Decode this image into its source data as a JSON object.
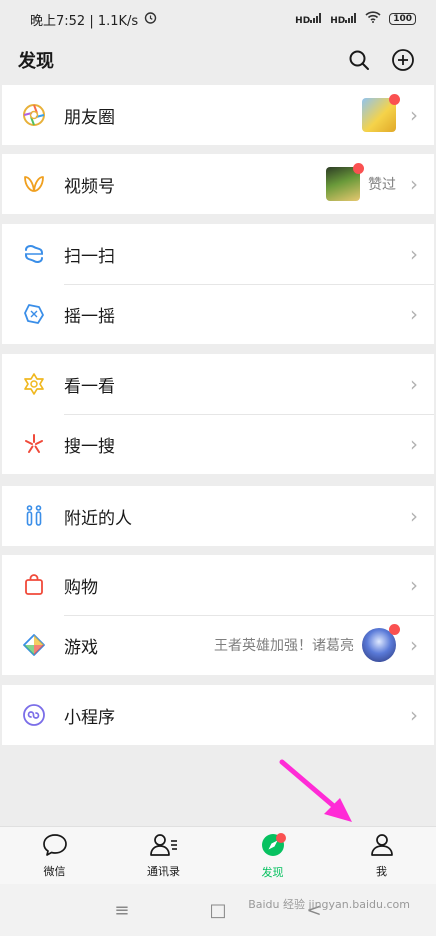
{
  "status": {
    "left_text": "晚上7:52 | 1.1K/s",
    "alarm_icon": "alarm-icon",
    "signal1": "HD",
    "signal2": "HD",
    "battery": "100"
  },
  "header": {
    "title": "发现",
    "search_icon": "search-icon",
    "add_icon": "plus-circle-icon"
  },
  "groups": {
    "moments": {
      "label": "朋友圈"
    },
    "channels": {
      "label": "视频号",
      "sub": "赞过"
    },
    "scan": {
      "label": "扫一扫"
    },
    "shake": {
      "label": "摇一摇"
    },
    "topstories": {
      "label": "看一看"
    },
    "search": {
      "label": "搜一搜"
    },
    "nearby": {
      "label": "附近的人"
    },
    "shopping": {
      "label": "购物"
    },
    "games": {
      "label": "游戏",
      "sub": "王者英雄加强！诸葛亮"
    },
    "miniprogram": {
      "label": "小程序"
    }
  },
  "tabbar": {
    "chats": "微信",
    "contacts": "通讯录",
    "discover": "发现",
    "me": "我"
  },
  "navbar": {
    "menu": "≡",
    "home": "□",
    "back": "<"
  },
  "watermark": "Baidu 经验 jingyan.baidu.com",
  "colors": {
    "accent_green": "#07c160",
    "badge_red": "#fa5151",
    "annotation_magenta": "#ff2bd6"
  }
}
